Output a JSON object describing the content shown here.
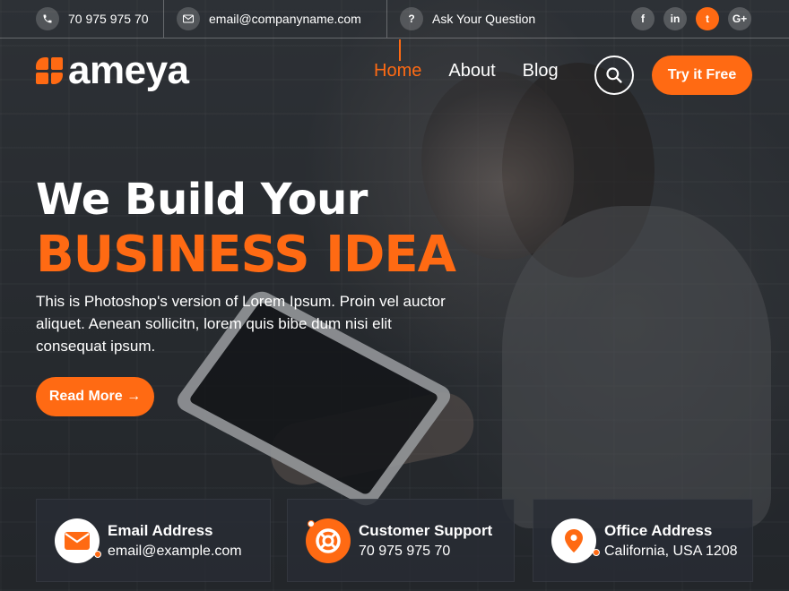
{
  "topbar": {
    "phone": "70 975 975 70",
    "email": "email@companyname.com",
    "question": "Ask Your Question",
    "social": [
      {
        "icon": "facebook-icon",
        "glyph": "f"
      },
      {
        "icon": "linkedin-icon",
        "glyph": "in"
      },
      {
        "icon": "twitter-icon",
        "glyph": "t"
      },
      {
        "icon": "google-plus-icon",
        "glyph": "G+"
      }
    ]
  },
  "brand": {
    "name": "ameya",
    "accent": "#ff6a13"
  },
  "nav": {
    "items": [
      "Home",
      "About",
      "Blog"
    ],
    "active": "Home",
    "cta": "Try it Free"
  },
  "hero": {
    "title_line1": "We Build Your",
    "title_line2": "BUSINESS IDEA",
    "description": "This is Photoshop's version  of Lorem Ipsum. Proin vel auctor aliquet. Aenean sollicitn, lorem quis bibe dum nisi elit consequat ipsum.",
    "button": "Read More →"
  },
  "info": [
    {
      "icon": "envelope-icon",
      "title": "Email Address",
      "value": "email@example.com"
    },
    {
      "icon": "lifebuoy-icon",
      "title": "Customer Support",
      "value": "70 975 975 70"
    },
    {
      "icon": "map-pin-icon",
      "title": "Office Address",
      "value": "California, USA 1208"
    }
  ]
}
